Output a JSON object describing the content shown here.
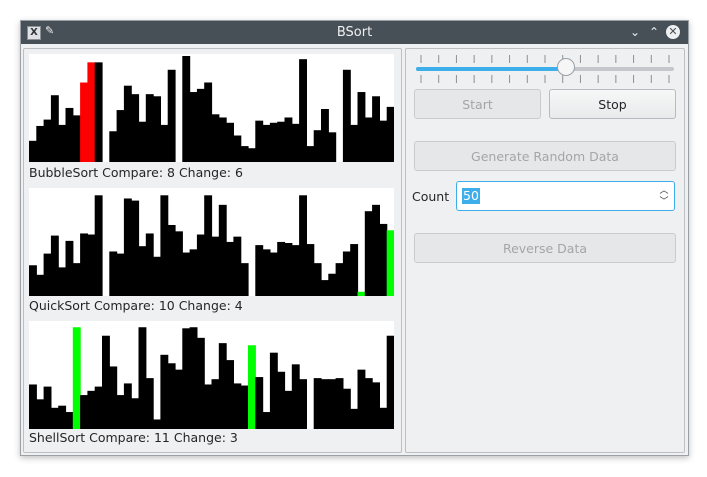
{
  "window": {
    "title": "BSort",
    "app_icon": "x-app-icon",
    "pin_icon": "pin-icon",
    "min_glyph": "⌄",
    "max_glyph": "⌃",
    "close_glyph": "✕"
  },
  "sorts": [
    {
      "label": "BubbleSort Compare: 8 Change: 6",
      "values": [
        20,
        34,
        40,
        63,
        35,
        51,
        44,
        75,
        94,
        94,
        0,
        29,
        49,
        72,
        64,
        38,
        64,
        62,
        35,
        87,
        0,
        100,
        66,
        69,
        75,
        45,
        42,
        37,
        25,
        15,
        13,
        39,
        35,
        37,
        38,
        42,
        36,
        97,
        15,
        30,
        50,
        28,
        0,
        87,
        35,
        66,
        42,
        62,
        39,
        52
      ],
      "highlights": {
        "7": "#ff0000",
        "8": "#ff0000"
      }
    },
    {
      "label": "QuickSort Compare: 10 Change: 4",
      "values": [
        29,
        20,
        40,
        57,
        27,
        52,
        31,
        59,
        58,
        95,
        0,
        42,
        40,
        92,
        90,
        47,
        59,
        37,
        95,
        67,
        61,
        41,
        44,
        58,
        95,
        56,
        86,
        51,
        56,
        31,
        0,
        48,
        44,
        41,
        51,
        50,
        48,
        95,
        49,
        31,
        15,
        21,
        31,
        42,
        49,
        4,
        80,
        86,
        68,
        62
      ],
      "highlights": {
        "45": "#00ff00",
        "49": "#00ff00"
      }
    },
    {
      "label": "ShellSort Compare: 11 Change: 3",
      "values": [
        42,
        28,
        40,
        20,
        22,
        16,
        96,
        32,
        36,
        40,
        88,
        59,
        32,
        43,
        29,
        96,
        48,
        9,
        70,
        62,
        56,
        95,
        96,
        86,
        42,
        47,
        81,
        65,
        43,
        41,
        79,
        49,
        16,
        72,
        54,
        36,
        61,
        47,
        0,
        48,
        47,
        47,
        48,
        38,
        19,
        56,
        48,
        44,
        20,
        88
      ],
      "highlights": {
        "6": "#00ff00",
        "30": "#00ff00"
      }
    }
  ],
  "controls": {
    "slider_value": 0.58,
    "start_label": "Start",
    "stop_label": "Stop",
    "generate_label": "Generate Random Data",
    "count_label": "Count",
    "count_value": "50",
    "reverse_label": "Reverse Data"
  }
}
